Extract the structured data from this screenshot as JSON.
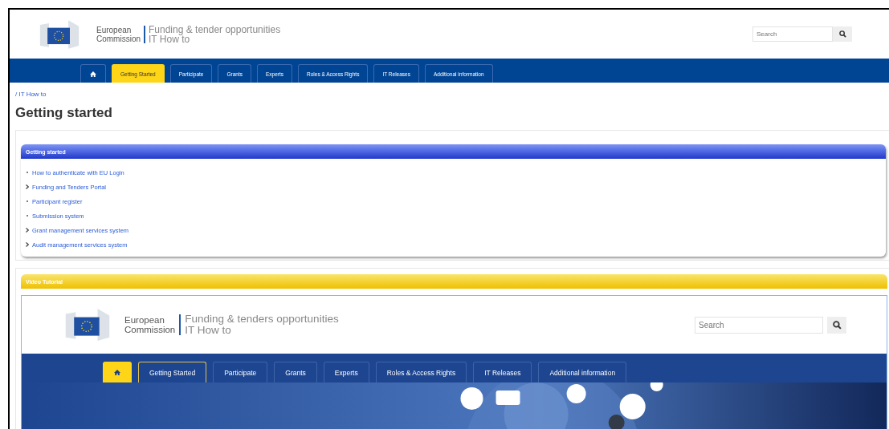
{
  "header": {
    "org_line_1": "European",
    "org_line_2": "Commission",
    "site_title": "Funding & tender opportunities",
    "site_subtitle": "IT How to",
    "search": {
      "placeholder": "Search"
    }
  },
  "nav": [
    {
      "kind": "home",
      "selected": false
    },
    {
      "kind": "text",
      "label": "Getting Started",
      "selected": true
    },
    {
      "kind": "text",
      "label": "Participate",
      "selected": false
    },
    {
      "kind": "text",
      "label": "Grants",
      "selected": false
    },
    {
      "kind": "text",
      "label": "Experts",
      "selected": false
    },
    {
      "kind": "text",
      "label": "Roles & Access Rights",
      "selected": false
    },
    {
      "kind": "text",
      "label": "IT Releases",
      "selected": false
    },
    {
      "kind": "text",
      "label": "Additional information",
      "selected": false
    }
  ],
  "breadcrumb": "/ IT How to",
  "page_title": "Getting started",
  "getting_started_panel": {
    "title": "Getting started",
    "items": [
      {
        "label": "How to authenticate with EU Login",
        "kind": "page"
      },
      {
        "label": "Funding and Tenders Portal",
        "kind": "section"
      },
      {
        "label": "Participant register",
        "kind": "page"
      },
      {
        "label": "Submission system",
        "kind": "page"
      },
      {
        "label": "Grant management services system",
        "kind": "section"
      },
      {
        "label": "Audit management services system",
        "kind": "section"
      }
    ]
  },
  "video_panel": {
    "title": "Video Tutorial",
    "video_frame": {
      "org_line_1": "European",
      "org_line_2": "Commission",
      "site_title": "Funding & tenders opportunities",
      "site_subtitle": "IT How to",
      "search": {
        "placeholder": "Search"
      },
      "nav": [
        {
          "kind": "home",
          "selected": true,
          "current": false
        },
        {
          "kind": "text",
          "label": "Getting Started",
          "selected": false,
          "current": true
        },
        {
          "kind": "text",
          "label": "Participate",
          "selected": false,
          "current": false
        },
        {
          "kind": "text",
          "label": "Grants",
          "selected": false,
          "current": false
        },
        {
          "kind": "text",
          "label": "Experts",
          "selected": false,
          "current": false
        },
        {
          "kind": "text",
          "label": "Roles & Access Rights",
          "selected": false,
          "current": false
        },
        {
          "kind": "text",
          "label": "IT Releases",
          "selected": false,
          "current": false
        },
        {
          "kind": "text",
          "label": "Additional information",
          "selected": false,
          "current": false
        }
      ]
    }
  }
}
